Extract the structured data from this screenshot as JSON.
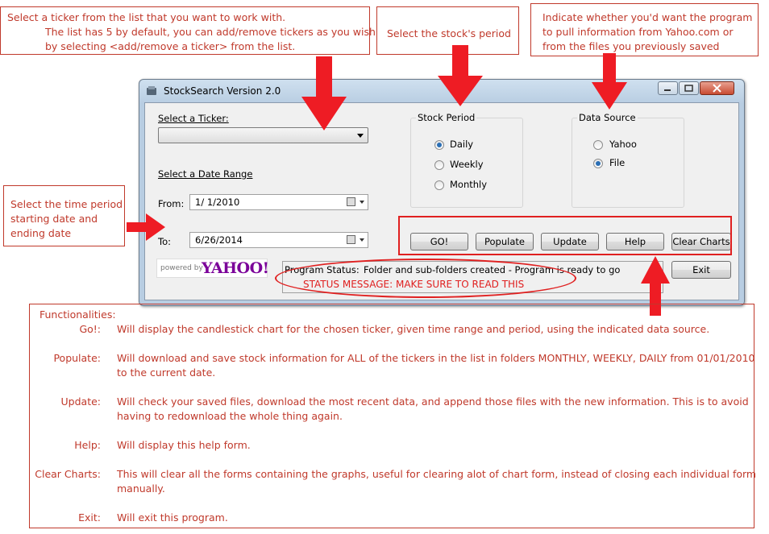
{
  "window": {
    "title": "StockSearch Version 2.0",
    "controls": [
      "minimize",
      "maximize",
      "close"
    ]
  },
  "ticker": {
    "label": "Select a Ticker:",
    "value": ""
  },
  "date_range": {
    "label": "Select a Date Range",
    "from_label": "From:",
    "from_value": "1/  1/2010",
    "to_label": "To:",
    "to_value": "6/26/2014"
  },
  "stock_period": {
    "caption": "Stock Period",
    "options": [
      {
        "label": "Daily",
        "selected": true
      },
      {
        "label": "Weekly",
        "selected": false
      },
      {
        "label": "Monthly",
        "selected": false
      }
    ]
  },
  "data_source": {
    "caption": "Data Source",
    "options": [
      {
        "label": "Yahoo",
        "selected": false
      },
      {
        "label": "File",
        "selected": true
      }
    ]
  },
  "buttons": {
    "go": "GO!",
    "populate": "Populate",
    "update": "Update",
    "help": "Help",
    "clear_charts": "Clear Charts",
    "exit": "Exit"
  },
  "status": {
    "label": "Program Status:",
    "message": "Folder and sub-folders created - Program is ready to go",
    "annotation": "STATUS MESSAGE: MAKE SURE TO READ THIS"
  },
  "yahoo_logo": {
    "powered_by": "powered by",
    "brand": "YAHOO!"
  },
  "annotations": {
    "ticker": [
      "Select a ticker from the list that you want to work with.",
      "The list has 5 by default, you can add/remove tickers as you wish",
      "by selecting <add/remove a ticker> from the list."
    ],
    "period": [
      "Select the stock's period"
    ],
    "source": [
      "Indicate whether you'd want the program",
      "to pull information from Yahoo.com or",
      "from the files you previously saved"
    ],
    "time": [
      "Select the time period",
      "starting date and",
      "ending date"
    ]
  },
  "functionalities": {
    "heading": "Functionalities:",
    "items": [
      {
        "key": "Go!:",
        "lines": [
          "Will display the candlestick chart for the chosen ticker, given time range and period, using the indicated data source."
        ]
      },
      {
        "key": "Populate:",
        "lines": [
          "Will download and save stock information for ALL of the tickers in the list in folders MONTHLY, WEEKLY, DAILY from 01/01/2010",
          "to the current date."
        ]
      },
      {
        "key": "Update:",
        "lines": [
          "Will check your saved files, download the most recent data, and append those files with the new information.  This is to avoid",
          "having to redownload the whole thing again."
        ]
      },
      {
        "key": "Help:",
        "lines": [
          "Will display this help form."
        ]
      },
      {
        "key": "Clear Charts:",
        "lines": [
          "This will clear all the forms containing the graphs, useful for clearing alot of chart form, instead of closing each individual form",
          "manually."
        ]
      },
      {
        "key": "Exit:",
        "lines": [
          "Will exit this program."
        ]
      }
    ]
  },
  "colors": {
    "annotation": "#c0392b",
    "highlight": "#e02020",
    "radio_dot": "#2b6fb5"
  }
}
